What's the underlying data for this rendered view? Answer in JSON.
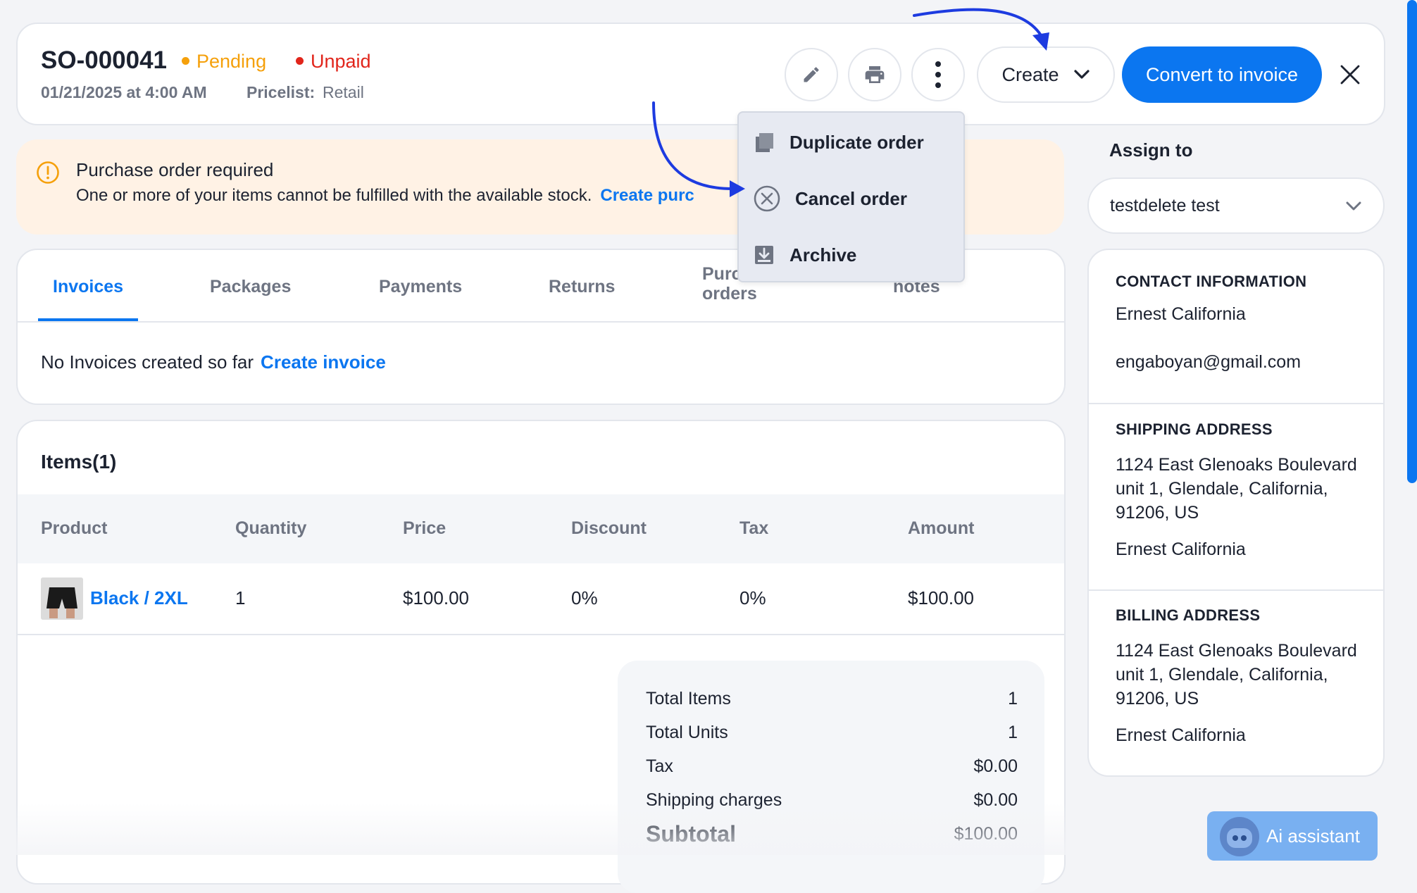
{
  "header": {
    "order_id": "SO-000041",
    "status": "Pending",
    "payment_status": "Unpaid",
    "date": "01/21/2025 at 4:00 AM",
    "pricelist_label": "Pricelist:",
    "pricelist_value": "Retail",
    "create_label": "Create",
    "convert_label": "Convert to invoice",
    "icons": [
      "pencil-icon",
      "printer-icon",
      "kebab-menu-icon",
      "chevron-down-icon",
      "close-icon"
    ],
    "colors": {
      "pending": "#f5a00b",
      "unpaid": "#e1251b",
      "accent": "#0b76f0"
    }
  },
  "alert": {
    "title": "Purchase order required",
    "text": "One or more of your items cannot be fulfilled with the available stock.",
    "link": "Create purc",
    "icon": "warning-circle-icon"
  },
  "dropdown": {
    "items": [
      {
        "label": "Duplicate order",
        "icon": "copy-icon"
      },
      {
        "label": "Cancel order",
        "icon": "cancel-circle-icon"
      },
      {
        "label": "Archive",
        "icon": "archive-download-icon"
      }
    ]
  },
  "tabs": {
    "items": [
      {
        "label": "Invoices"
      },
      {
        "label": "Packages"
      },
      {
        "label": "Payments"
      },
      {
        "label": "Returns"
      },
      {
        "label": "Purc\norders"
      },
      {
        "label": "notes"
      }
    ],
    "active": "Invoices",
    "empty_text": "No Invoices created so far",
    "empty_link": "Create invoice"
  },
  "items": {
    "title": "Items(1)",
    "columns": [
      "Product",
      "Quantity",
      "Price",
      "Discount",
      "Tax",
      "Amount"
    ],
    "rows": [
      {
        "product": "Black / 2XL",
        "quantity": "1",
        "price": "$100.00",
        "discount": "0%",
        "tax": "0%",
        "amount": "$100.00"
      }
    ],
    "totals": [
      {
        "label": "Total Items",
        "value": "1"
      },
      {
        "label": "Total Units",
        "value": "1"
      },
      {
        "label": "Tax",
        "value": "$0.00"
      },
      {
        "label": "Shipping charges",
        "value": "$0.00"
      },
      {
        "label": "Subtotal",
        "value": "$100.00"
      }
    ]
  },
  "sidebar": {
    "assign_label": "Assign to",
    "assign_value": "testdelete test",
    "contact_title": "CONTACT INFORMATION",
    "contact_name": "Ernest California",
    "contact_email": "engaboyan@gmail.com",
    "shipping_title": "SHIPPING ADDRESS",
    "shipping_address": "1124 East Glenoaks Boulevard unit 1, Glendale, California, 91206, US",
    "shipping_name": "Ernest California",
    "billing_title": "BILLING ADDRESS",
    "billing_address": "1124 East Glenoaks Boulevard unit 1, Glendale, California, 91206, US",
    "billing_name": "Ernest California"
  },
  "assistant": {
    "label": "Ai assistant"
  }
}
